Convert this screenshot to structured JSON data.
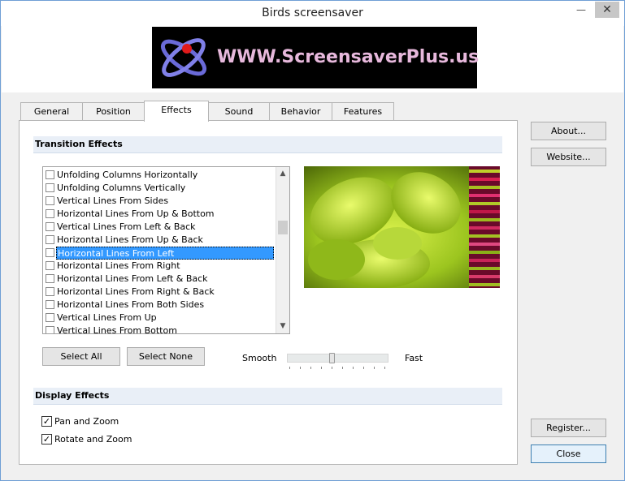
{
  "window": {
    "title": "Birds screensaver",
    "minimize_glyph": "—",
    "close_glyph": "✕"
  },
  "banner": {
    "text": "WWW.ScreensaverPlus.us",
    "icon": "atom-logo-icon"
  },
  "tabs": [
    {
      "label": "General",
      "active": false
    },
    {
      "label": "Position",
      "active": false
    },
    {
      "label": "Effects",
      "active": true
    },
    {
      "label": "Sound",
      "active": false
    },
    {
      "label": "Behavior",
      "active": false
    },
    {
      "label": "Features",
      "active": false
    }
  ],
  "transition": {
    "heading": "Transition Effects",
    "items": [
      {
        "label": "Unfolding Columns Horizontally",
        "checked": false,
        "selected": false
      },
      {
        "label": "Unfolding Columns Vertically",
        "checked": false,
        "selected": false
      },
      {
        "label": "Vertical Lines From Sides",
        "checked": false,
        "selected": false
      },
      {
        "label": "Horizontal Lines From Up & Bottom",
        "checked": false,
        "selected": false
      },
      {
        "label": "Vertical Lines From Left & Back",
        "checked": false,
        "selected": false
      },
      {
        "label": "Horizontal Lines From Up & Back",
        "checked": false,
        "selected": false
      },
      {
        "label": "Horizontal Lines From Left",
        "checked": false,
        "selected": true
      },
      {
        "label": "Horizontal Lines From Right",
        "checked": false,
        "selected": false
      },
      {
        "label": "Horizontal Lines From Left & Back",
        "checked": false,
        "selected": false
      },
      {
        "label": "Horizontal Lines From Right & Back",
        "checked": false,
        "selected": false
      },
      {
        "label": "Horizontal Lines From Both Sides",
        "checked": false,
        "selected": false
      },
      {
        "label": "Vertical Lines From Up",
        "checked": false,
        "selected": false
      },
      {
        "label": "Vertical Lines From Bottom",
        "checked": false,
        "selected": false
      }
    ],
    "scroll_up_glyph": "▲",
    "scroll_down_glyph": "▼",
    "select_all_label": "Select All",
    "select_none_label": "Select None",
    "speed_min_label": "Smooth",
    "speed_max_label": "Fast",
    "speed_value_fraction": 0.43
  },
  "display": {
    "heading": "Display Effects",
    "options": [
      {
        "label": "Pan and Zoom",
        "checked": true
      },
      {
        "label": "Rotate and Zoom",
        "checked": true
      }
    ],
    "check_glyph": "✓"
  },
  "side_buttons": {
    "about": "About...",
    "website": "Website...",
    "register": "Register...",
    "close": "Close"
  },
  "colors": {
    "selection": "#3399ff",
    "section_bg": "#e9eff7",
    "banner_text": "#e7b8dc"
  }
}
